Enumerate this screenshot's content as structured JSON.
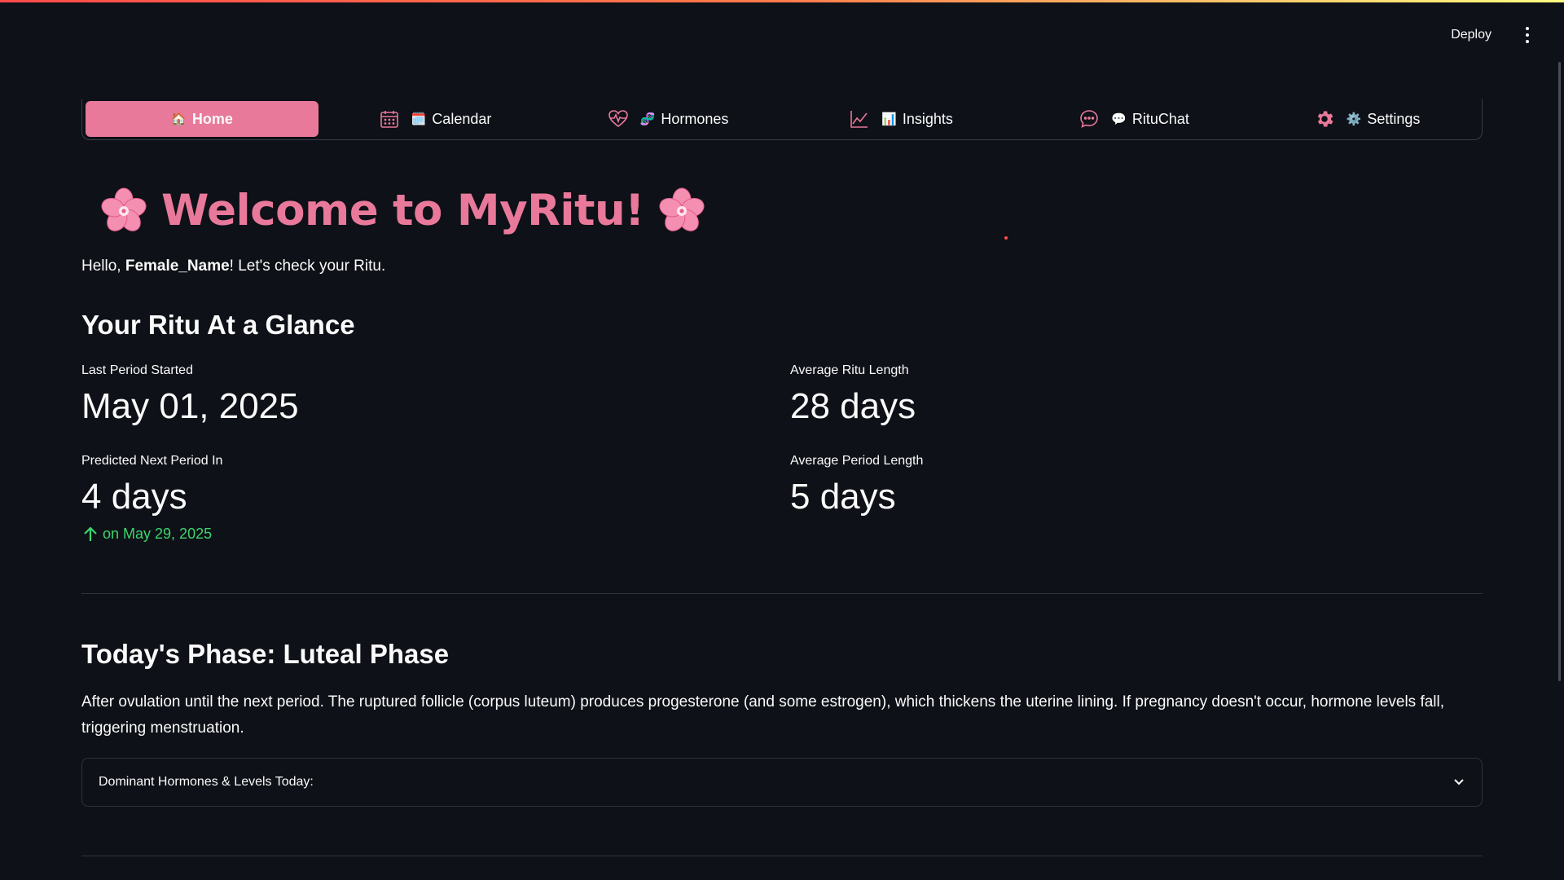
{
  "header": {
    "deploy_label": "Deploy",
    "menu_icon": "more-vertical-icon"
  },
  "nav": {
    "tabs": [
      {
        "label": "Home",
        "emoji": "🏠",
        "active": true
      },
      {
        "label": "Calendar",
        "emoji": "🗓️",
        "icon": "calendar-icon",
        "active": false
      },
      {
        "label": "Hormones",
        "emoji": "🧬",
        "icon": "heartbeat-icon",
        "active": false
      },
      {
        "label": "Insights",
        "emoji": "📊",
        "icon": "chart-line-icon",
        "active": false
      },
      {
        "label": "RituChat",
        "emoji": "💬",
        "icon": "chat-icon",
        "active": false
      },
      {
        "label": "Settings",
        "emoji": "⚙️",
        "icon": "gear-icon",
        "active": false
      }
    ],
    "accent_color": "#e8799a"
  },
  "welcome": {
    "title": "Welcome to MyRitu!",
    "greeting_prefix": "Hello, ",
    "user_name": "Female_Name",
    "greeting_suffix": "! Let's check your Ritu."
  },
  "glance": {
    "heading": "Your Ritu At a Glance",
    "last_period_label": "Last Period Started",
    "last_period_value": "May 01, 2025",
    "avg_ritu_label": "Average Ritu Length",
    "avg_ritu_value": "28 days",
    "next_period_label": "Predicted Next Period In",
    "next_period_value": "4 days",
    "next_period_delta": "on May 29, 2025",
    "avg_period_label": "Average Period Length",
    "avg_period_value": "5 days",
    "delta_color": "#3dd56d"
  },
  "phase": {
    "heading": "Today's Phase: Luteal Phase",
    "description": "After ovulation until the next period. The ruptured follicle (corpus luteum) produces progesterone (and some estrogen), which thickens the uterine lining. If pregnancy doesn't occur, hormone levels fall, triggering menstruation.",
    "expander_label": "Dominant Hormones & Levels Today:"
  }
}
